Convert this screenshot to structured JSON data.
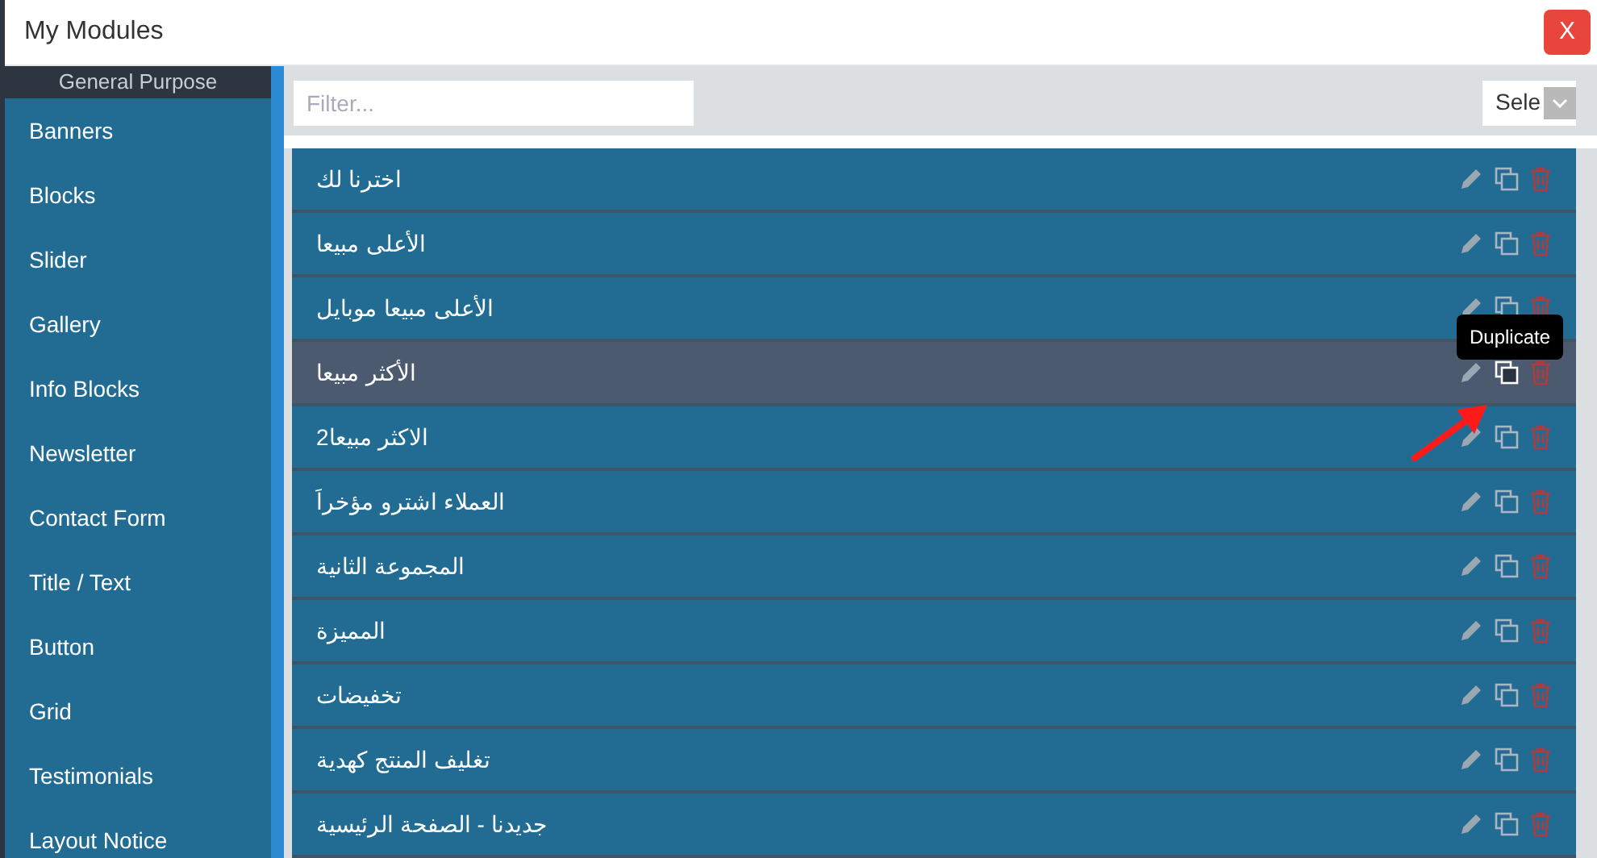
{
  "window": {
    "title": "My Modules",
    "close_label": "X"
  },
  "sidebar": {
    "header": "General Purpose",
    "items": [
      {
        "label": "Banners"
      },
      {
        "label": "Blocks"
      },
      {
        "label": "Slider"
      },
      {
        "label": "Gallery"
      },
      {
        "label": "Info Blocks"
      },
      {
        "label": "Newsletter"
      },
      {
        "label": "Contact Form"
      },
      {
        "label": "Title / Text"
      },
      {
        "label": "Button"
      },
      {
        "label": "Grid"
      },
      {
        "label": "Testimonials"
      },
      {
        "label": "Layout Notice"
      }
    ]
  },
  "filter": {
    "placeholder": "Filter..."
  },
  "select": {
    "value": "Sele"
  },
  "modules": [
    {
      "label": "اخترنا لك",
      "highlighted": false
    },
    {
      "label": "الأعلى مبيعا",
      "highlighted": false
    },
    {
      "label": "الأعلى مبيعا موبايل",
      "highlighted": false
    },
    {
      "label": "الأكثر مبيعا",
      "highlighted": true
    },
    {
      "label": "الاكثر مبيعا2",
      "highlighted": false
    },
    {
      "label": "العملاء اشترو مؤخراَ",
      "highlighted": false
    },
    {
      "label": "المجموعة الثانية",
      "highlighted": false
    },
    {
      "label": "المميزة",
      "highlighted": false
    },
    {
      "label": "تخفيضات",
      "highlighted": false
    },
    {
      "label": "تغليف المنتج كهدية",
      "highlighted": false
    },
    {
      "label": "جديدنا - الصفحة الرئيسية",
      "highlighted": false
    }
  ],
  "tooltip": {
    "text": "Duplicate"
  }
}
